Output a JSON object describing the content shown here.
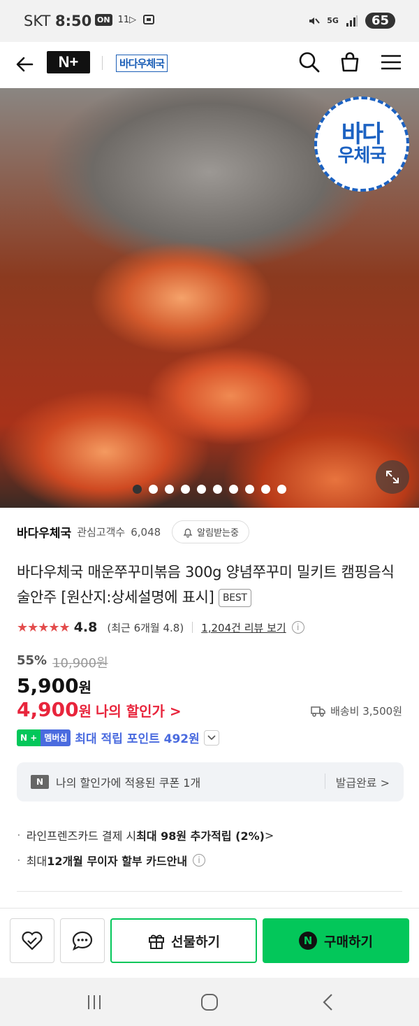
{
  "status_bar": {
    "carrier": "SKT",
    "time": "8:50",
    "icon_on": "ON",
    "icon_11": "11▷",
    "signal_5g": "5G",
    "battery": "65"
  },
  "header": {
    "logo": "N+",
    "brand_logo": "바다우체국",
    "icons": [
      "back-arrow-icon",
      "search-icon",
      "cart-icon",
      "menu-icon"
    ]
  },
  "hero": {
    "badge_line1": "바다",
    "badge_line2": "우체국",
    "dots_total": 10,
    "active_dot": 1
  },
  "store": {
    "name": "바다우체국",
    "fans_label": "관심고객수",
    "fans_count": "6,048",
    "alarm_label": "알림받는중"
  },
  "product": {
    "title": "바다우체국 매운쭈꾸미볶음 300g 양념쭈꾸미 밀키트 캠핑음식 술안주 [원산지:상세설명에 표시]",
    "best_badge": "BEST"
  },
  "rating": {
    "stars": "★★★★★",
    "score": "4.8",
    "recent": "(최근 6개월 4.8)",
    "reviews_link": "1,204건 리뷰 보기"
  },
  "price": {
    "discount_rate": "55%",
    "original": "10,900원",
    "sale": "5,900",
    "won": "원",
    "my_price": "4,900",
    "my_price_label": "나의 할인가 >",
    "shipping": "배송비 3,500원"
  },
  "membership": {
    "badge_n": "N +",
    "badge_label": "멤버십",
    "points": "최대 적립 포인트 492원"
  },
  "coupon": {
    "logo": "N",
    "text": "나의 할인가에 적용된 쿠폰 1개",
    "action": "발급완료 >"
  },
  "benefits": [
    {
      "pre": "라인프렌즈카드 결제 시 ",
      "bold": "최대 98원 추가적립 (2%)",
      "post": " >"
    },
    {
      "pre": "최대 ",
      "bold": "12개월 무이자 할부 카드안내",
      "post": ""
    }
  ],
  "actions": {
    "gift": "선물하기",
    "buy": "구매하기",
    "buy_logo": "N"
  },
  "colors": {
    "naver_green": "#03c75a",
    "price_red": "#e8253c",
    "member_blue": "#4a6bdf",
    "brand_blue": "#1c62c2"
  }
}
